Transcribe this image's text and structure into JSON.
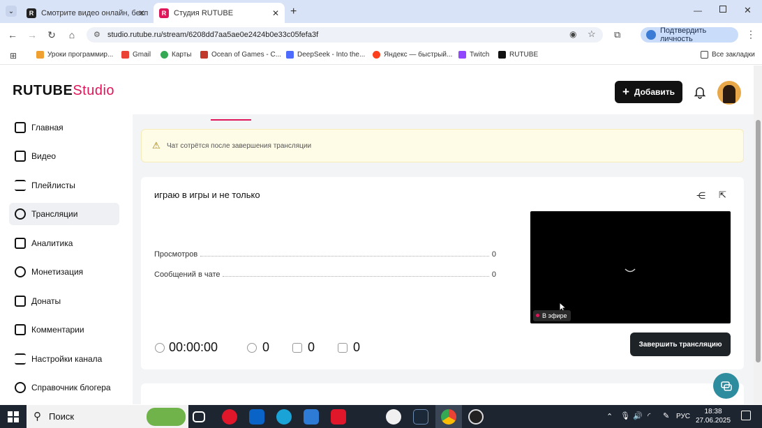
{
  "browser": {
    "tabs": [
      {
        "title": "Смотрите видео онлайн, бесп",
        "active": false
      },
      {
        "title": "Студия RUTUBE",
        "active": true
      }
    ],
    "url": "studio.rutube.ru/stream/6208dd7aa5ae0e2424b0e33c05fefa3f",
    "verify_label": "Подтвердить личность",
    "bookmarks": [
      "Уроки программир...",
      "Gmail",
      "Карты",
      "Ocean of Games - C...",
      "DeepSeek - Into the...",
      "Яндекс — быстрый...",
      "Twitch",
      "RUTUBE"
    ],
    "all_bookmarks": "Все закладки"
  },
  "header": {
    "logo_main": "RUTUBE",
    "logo_studio": "Studio",
    "add_label": "Добавить"
  },
  "sidebar": {
    "items": [
      {
        "label": "Главная",
        "icon": "home-icon",
        "active": false
      },
      {
        "label": "Видео",
        "icon": "video-icon",
        "active": false
      },
      {
        "label": "Плейлисты",
        "icon": "playlist-icon",
        "active": false
      },
      {
        "label": "Трансляции",
        "icon": "broadcast-icon",
        "active": true
      },
      {
        "label": "Аналитика",
        "icon": "analytics-icon",
        "active": false
      },
      {
        "label": "Монетизация",
        "icon": "monetization-icon",
        "active": false
      },
      {
        "label": "Донаты",
        "icon": "donate-icon",
        "active": false
      },
      {
        "label": "Комментарии",
        "icon": "comments-icon",
        "active": false
      },
      {
        "label": "Настройки канала",
        "icon": "settings-icon",
        "active": false
      },
      {
        "label": "Справочник блогера",
        "icon": "handbook-icon",
        "active": false
      }
    ]
  },
  "main": {
    "warning": "Чат сотрётся после завершения трансляции",
    "stream_title": "играю в игры и не только",
    "stats": [
      {
        "label": "Просмотров",
        "value": "0"
      },
      {
        "label": "Сообщений в чате",
        "value": "0"
      }
    ],
    "live_badge": "В эфире",
    "timer": "00:00:00",
    "viewers": "0",
    "likes": "0",
    "dislikes": "0",
    "end_label": "Завершить трансляцию"
  },
  "taskbar": {
    "search_label": "Поиск",
    "lang": "РУС",
    "time": "18:38",
    "date": "27.06.2025"
  },
  "colors": {
    "brand": "#e0165a",
    "primary_button": "#111111",
    "end_button": "#1e2328",
    "warning_bg": "#fefbe6"
  }
}
